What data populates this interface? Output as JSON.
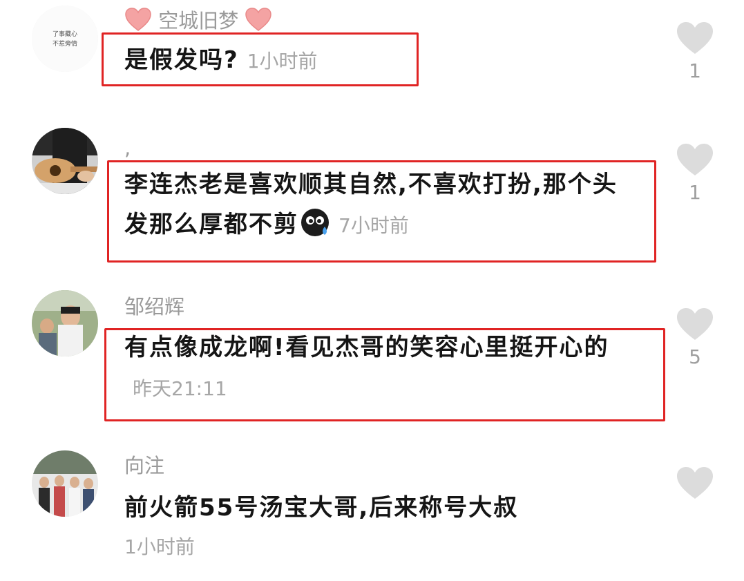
{
  "comments": [
    {
      "username": "空城旧梦",
      "text": "是假发吗?",
      "time": "1小时前",
      "likes": "1",
      "avatar_lettering": [
        "了事藏心",
        "不惹旁情"
      ]
    },
    {
      "username": ",",
      "text": "李连杰老是喜欢顺其自然,不喜欢打扮,那个头发那么厚都不剪",
      "time": "7小时前",
      "likes": "1"
    },
    {
      "username": "邹绍辉",
      "text": "有点像成龙啊!看见杰哥的笑容心里挺开心的",
      "time": "昨天21:11",
      "likes": "5"
    },
    {
      "username": "向注",
      "text": "前火箭55号汤宝大哥,后来称号大叔",
      "time": "1小时前",
      "likes": ""
    }
  ],
  "colors": {
    "highlight": "#e02424",
    "heart": "#dcdcdc",
    "muted_text": "#9a9a9a",
    "username_heart_emoji": "#f4a3a3"
  },
  "icons": {
    "like": "heart-icon",
    "username_decoration": "pink-heart-emoji",
    "crying_emoji": "crying-face-emoji"
  }
}
